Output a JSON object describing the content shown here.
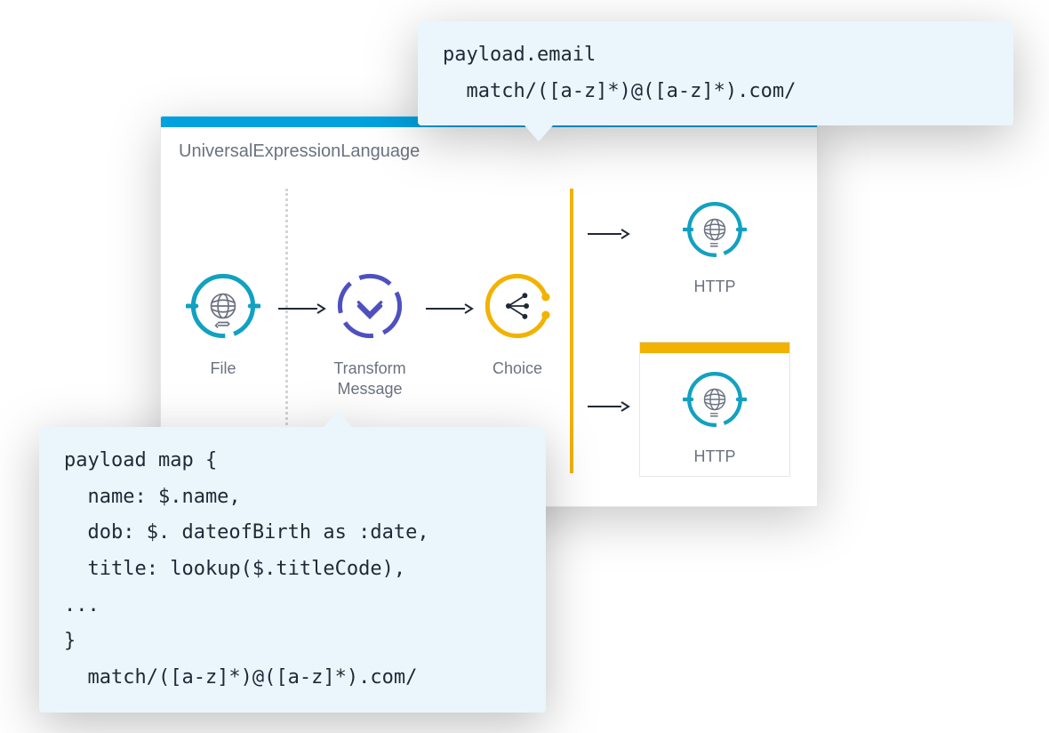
{
  "panel": {
    "title": "UniversalExpressionLanguage"
  },
  "nodes": {
    "file": {
      "label": "File"
    },
    "transform": {
      "label": "Transform\nMessage"
    },
    "choice": {
      "label": "Choice"
    },
    "httpTop": {
      "label": "HTTP"
    },
    "httpBottom": {
      "label": "HTTP"
    }
  },
  "speeches": {
    "top": "payload.email\n  match/([a-z]*)@([a-z]*).com/",
    "bottom": "payload map {\n  name: $.name,\n  dob: $. dateofBirth as :date,\n  title: lookup($.titleCode),\n...\n}\n  match/([a-z]*)@([a-z]*).com/"
  },
  "colors": {
    "teal": "#11a1c1",
    "indigo": "#4f50c0",
    "orange": "#f2b200",
    "blueBar": "#00a1df",
    "textMuted": "#6b7280"
  }
}
